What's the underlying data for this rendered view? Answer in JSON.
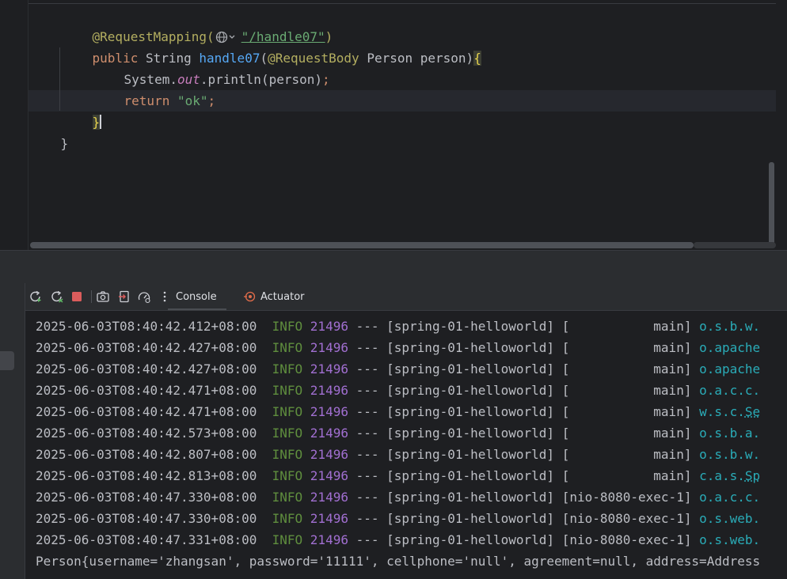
{
  "editor": {
    "lines": [
      {
        "annotation": "@RequestMapping(",
        "url": "\"/handle07\"",
        "close": ")"
      },
      {
        "kw": "public",
        "type": " String ",
        "method": "handle07",
        "paren_open": "(",
        "param_ann": "@RequestBody",
        "param": " Person person)",
        "brace": "{"
      },
      {
        "obj": "System.",
        "static_field": "out",
        "call": ".println(person)",
        "semi": ";"
      },
      {
        "kw": "return ",
        "str": "\"ok\"",
        "semi": ";"
      },
      {
        "brace": "}"
      },
      {
        "brace": "}"
      }
    ]
  },
  "toolbar": {
    "icons": [
      "rerun-icon",
      "restart-icon",
      "stop-icon",
      "camera-icon",
      "exit-icon",
      "gauge-icon",
      "more-vert-icon"
    ],
    "tabs": [
      {
        "label": "Console",
        "active": true
      },
      {
        "label": "Actuator",
        "active": false
      }
    ]
  },
  "console": {
    "lines": [
      {
        "ts": "2025-06-03T08:40:42.412+08:00",
        "level": "INFO",
        "pid": "21496",
        "sep": " --- ",
        "app": "[spring-01-helloworld]",
        "thread": " [           main] ",
        "logger": "o.s.b.w."
      },
      {
        "ts": "2025-06-03T08:40:42.427+08:00",
        "level": "INFO",
        "pid": "21496",
        "sep": " --- ",
        "app": "[spring-01-helloworld]",
        "thread": " [           main] ",
        "logger": "o.apache"
      },
      {
        "ts": "2025-06-03T08:40:42.427+08:00",
        "level": "INFO",
        "pid": "21496",
        "sep": " --- ",
        "app": "[spring-01-helloworld]",
        "thread": " [           main] ",
        "logger": "o.apache"
      },
      {
        "ts": "2025-06-03T08:40:42.471+08:00",
        "level": "INFO",
        "pid": "21496",
        "sep": " --- ",
        "app": "[spring-01-helloworld]",
        "thread": " [           main] ",
        "logger": "o.a.c.c."
      },
      {
        "ts": "2025-06-03T08:40:42.471+08:00",
        "level": "INFO",
        "pid": "21496",
        "sep": " --- ",
        "app": "[spring-01-helloworld]",
        "thread": " [           main] ",
        "logger": "w.s.c.",
        "logger_link": "Se"
      },
      {
        "ts": "2025-06-03T08:40:42.573+08:00",
        "level": "INFO",
        "pid": "21496",
        "sep": " --- ",
        "app": "[spring-01-helloworld]",
        "thread": " [           main] ",
        "logger": "o.s.b.a."
      },
      {
        "ts": "2025-06-03T08:40:42.807+08:00",
        "level": "INFO",
        "pid": "21496",
        "sep": " --- ",
        "app": "[spring-01-helloworld]",
        "thread": " [           main] ",
        "logger": "o.s.b.w."
      },
      {
        "ts": "2025-06-03T08:40:42.813+08:00",
        "level": "INFO",
        "pid": "21496",
        "sep": " --- ",
        "app": "[spring-01-helloworld]",
        "thread": " [           main] ",
        "logger": "c.a.s.",
        "logger_link": "Sp"
      },
      {
        "ts": "2025-06-03T08:40:47.330+08:00",
        "level": "INFO",
        "pid": "21496",
        "sep": " --- ",
        "app": "[spring-01-helloworld]",
        "thread": " [nio-8080-exec-1] ",
        "logger": "o.a.c.c."
      },
      {
        "ts": "2025-06-03T08:40:47.330+08:00",
        "level": "INFO",
        "pid": "21496",
        "sep": " --- ",
        "app": "[spring-01-helloworld]",
        "thread": " [nio-8080-exec-1] ",
        "logger": "o.s.web."
      },
      {
        "ts": "2025-06-03T08:40:47.331+08:00",
        "level": "INFO",
        "pid": "21496",
        "sep": " --- ",
        "app": "[spring-01-helloworld]",
        "thread": " [nio-8080-exec-1] ",
        "logger": "o.s.web."
      }
    ],
    "output_line": "Person{username='zhangsan', password='11111', cellphone='null', agreement=null, address=Address"
  },
  "colors": {
    "background": "#1e1f22",
    "annotation": "#b3ae60",
    "keyword": "#cf8e6d",
    "method": "#56a8f5",
    "string": "#6aab73",
    "static_field": "#c77dbb",
    "log_info": "#5f8e3e",
    "log_pid": "#a16fd1",
    "log_logger": "#2aacb8"
  }
}
